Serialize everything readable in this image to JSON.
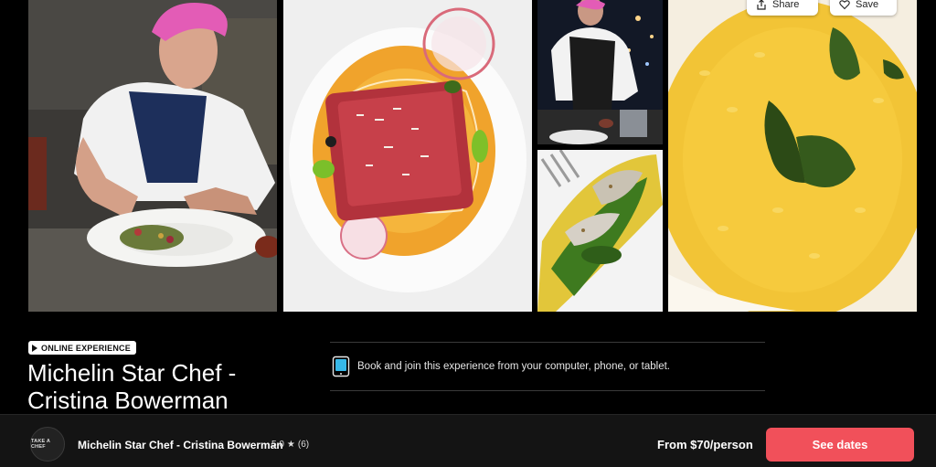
{
  "gallery": {
    "photos": [
      {
        "name": "chef-plating-photo"
      },
      {
        "name": "tuna-dish-photo"
      },
      {
        "name": "chef-kitchen-photo"
      },
      {
        "name": "fish-dish-photo"
      },
      {
        "name": "risotto-photo"
      }
    ]
  },
  "actions": {
    "share_label": "Share",
    "save_label": "Save",
    "share_icon": "share-icon",
    "save_icon": "heart-icon"
  },
  "experience": {
    "badge": "ONLINE EXPERIENCE",
    "title": "Michelin Star Chef - Cristina Bowerman",
    "feature_text": "Book and join this experience from your computer, phone, or tablet.",
    "feature_icon": "tablet-icon"
  },
  "footer": {
    "avatar_text": "TAKE A CHEF",
    "title": "Michelin Star Chef - Cristina Bowerman",
    "rating": "5.0",
    "rating_icon": "star-icon",
    "reviews": "(6)",
    "price": "From $70/person",
    "cta": "See dates"
  },
  "colors": {
    "background": "#000000",
    "cta": "#f1505a",
    "footer": "#141414"
  }
}
